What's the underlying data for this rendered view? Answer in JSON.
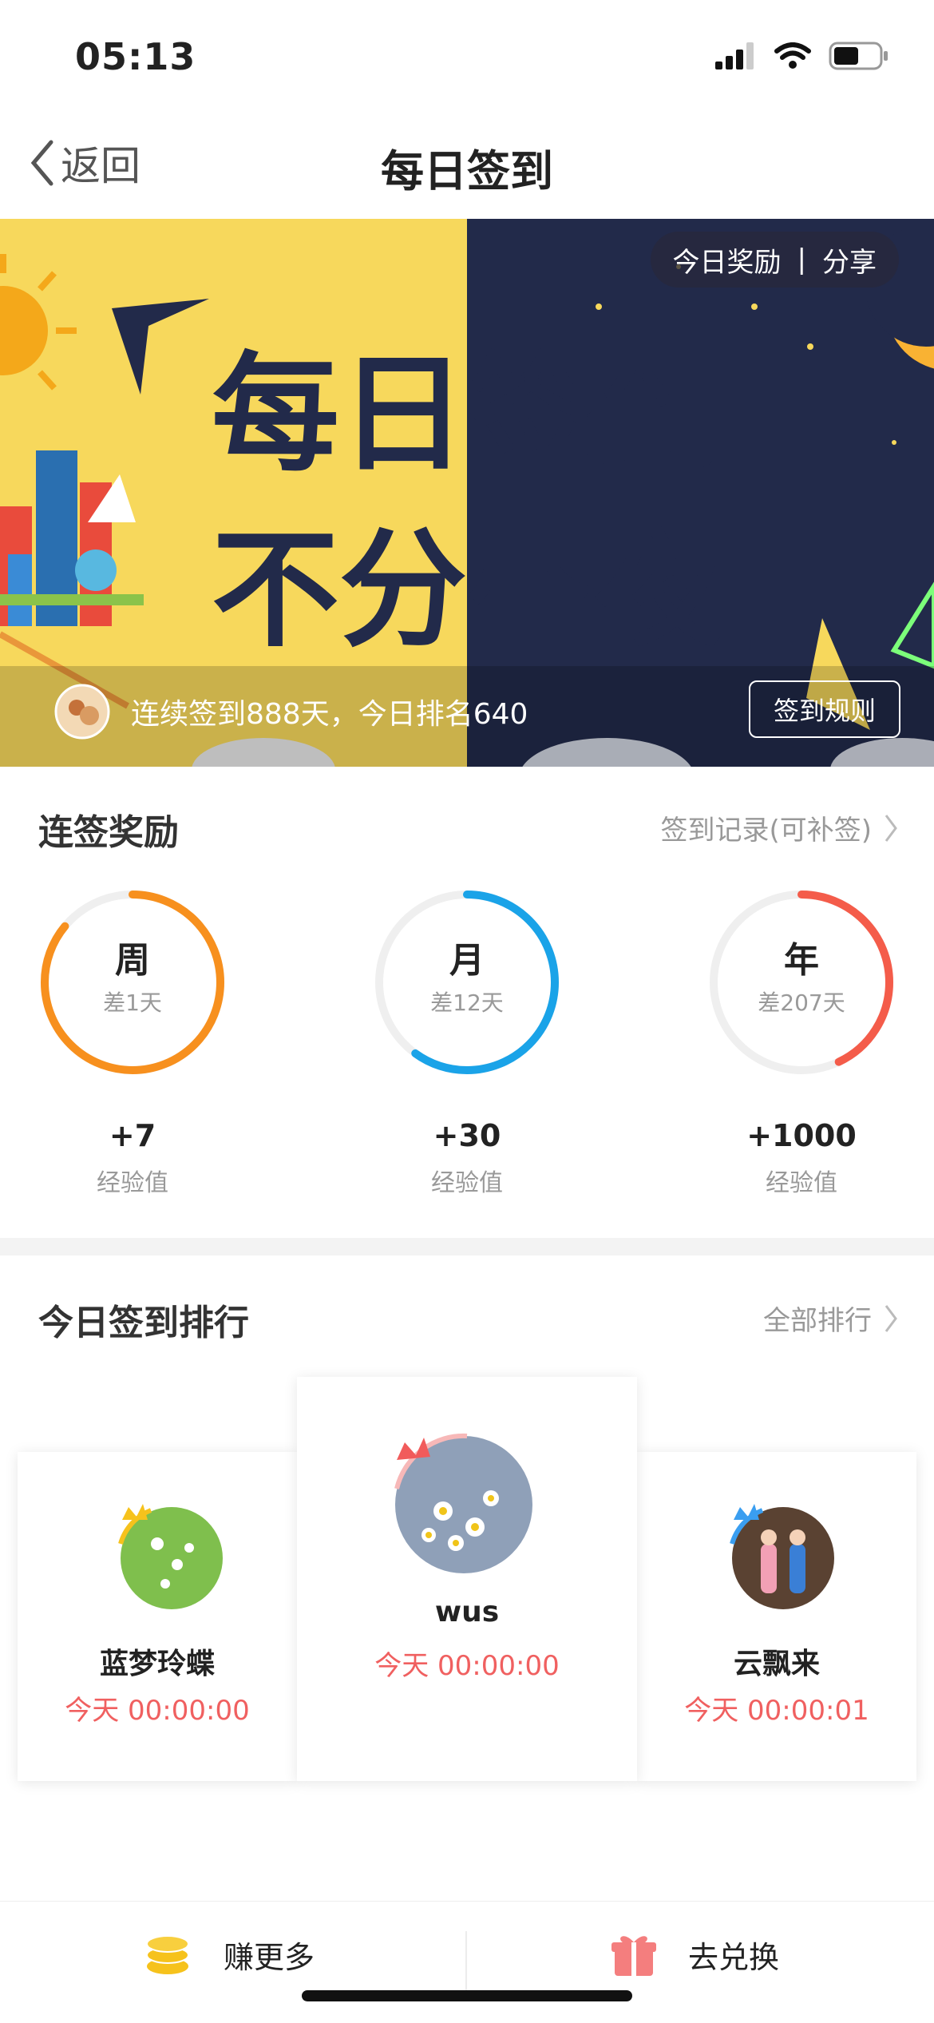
{
  "status": {
    "time": "05:13"
  },
  "nav": {
    "back_label": "返回",
    "title": "每日签到"
  },
  "banner": {
    "headline_line1": "每日签到",
    "headline_line2": "不分昼夜",
    "today_reward": "今日奖励",
    "separator": "|",
    "share": "分享",
    "streak_text": "连续签到888天，今日排名640",
    "rules_button": "签到规则"
  },
  "rewards": {
    "title": "连签奖励",
    "record_link": "签到记录(可补签)",
    "items": [
      {
        "period": "周",
        "remaining": "差1天",
        "value": "+7",
        "unit": "经验值",
        "progress": 0.86,
        "color": "#f7901e"
      },
      {
        "period": "月",
        "remaining": "差12天",
        "value": "+30",
        "unit": "经验值",
        "progress": 0.6,
        "color": "#1aa3e8"
      },
      {
        "period": "年",
        "remaining": "差207天",
        "value": "+1000",
        "unit": "经验值",
        "progress": 0.43,
        "color": "#f45c4a"
      }
    ]
  },
  "ranking": {
    "title": "今日签到排行",
    "all_link": "全部排行",
    "entries": [
      {
        "name": "蓝梦玲蝶",
        "time": "今天 00:00:00",
        "crown_color": "#f6c21c",
        "rank": 2
      },
      {
        "name": "wus",
        "time": "今天 00:00:00",
        "crown_color": "#f15b5b",
        "rank": 1
      },
      {
        "name": "云飘来",
        "time": "今天 00:00:01",
        "crown_color": "#3a9ef0",
        "rank": 3
      }
    ]
  },
  "bottom": {
    "earn_more": "赚更多",
    "exchange": "去兑换"
  },
  "colors": {
    "accent_red": "#f06060",
    "banner_yellow": "#f7d85c",
    "banner_night": "#222a4a"
  }
}
